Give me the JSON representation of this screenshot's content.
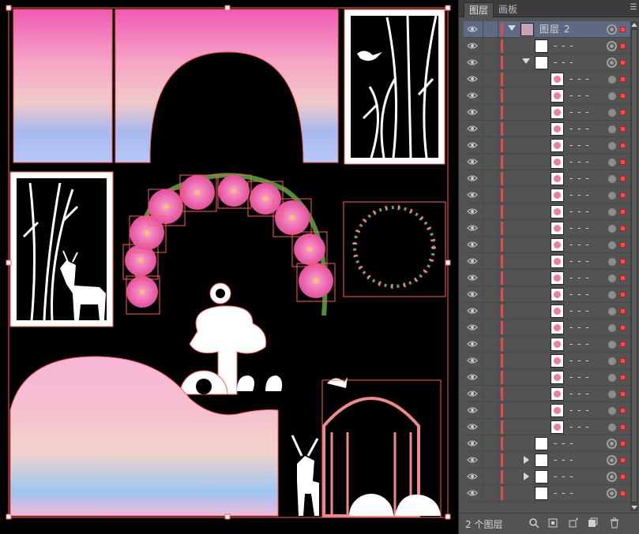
{
  "panel": {
    "tabs": [
      {
        "label": "图层"
      },
      {
        "label": "画板"
      }
    ],
    "menu_icon": "panel-menu-icon",
    "footer": {
      "count_label": "2 个图层"
    },
    "rows": [
      {
        "name": "图层 2",
        "kind": "layer"
      },
      {
        "name": "- - -",
        "kind": "group"
      },
      {
        "name": "- - -",
        "kind": "group-open"
      },
      {
        "name": "- - -",
        "kind": "item"
      },
      {
        "name": "- - -",
        "kind": "item"
      },
      {
        "name": "- - -",
        "kind": "item"
      },
      {
        "name": "- - -",
        "kind": "item"
      },
      {
        "name": "- - -",
        "kind": "item"
      },
      {
        "name": "- - -",
        "kind": "item"
      },
      {
        "name": "- - -",
        "kind": "item"
      },
      {
        "name": "- - -",
        "kind": "item"
      },
      {
        "name": "- - -",
        "kind": "item"
      },
      {
        "name": "- - -",
        "kind": "item"
      },
      {
        "name": "- - -",
        "kind": "item"
      },
      {
        "name": "- - -",
        "kind": "item"
      },
      {
        "name": "- - -",
        "kind": "item"
      },
      {
        "name": "- - -",
        "kind": "item"
      },
      {
        "name": "- - -",
        "kind": "item"
      },
      {
        "name": "- - -",
        "kind": "item"
      },
      {
        "name": "- - -",
        "kind": "item"
      },
      {
        "name": "- - -",
        "kind": "item"
      },
      {
        "name": "- - -",
        "kind": "item"
      },
      {
        "name": "- - -",
        "kind": "item"
      },
      {
        "name": "- - -",
        "kind": "item"
      },
      {
        "name": "- - -",
        "kind": "item"
      },
      {
        "name": "- - -",
        "kind": "group-ring"
      },
      {
        "name": "- - -",
        "kind": "group-closed"
      },
      {
        "name": "- - -",
        "kind": "group-closed"
      },
      {
        "name": "- - -",
        "kind": "group"
      }
    ]
  },
  "colors": {
    "selection": "#ff5a5a",
    "layer_bar": "#e34a4a",
    "canvas_bg": "#000000",
    "panel_bg": "#535353"
  }
}
